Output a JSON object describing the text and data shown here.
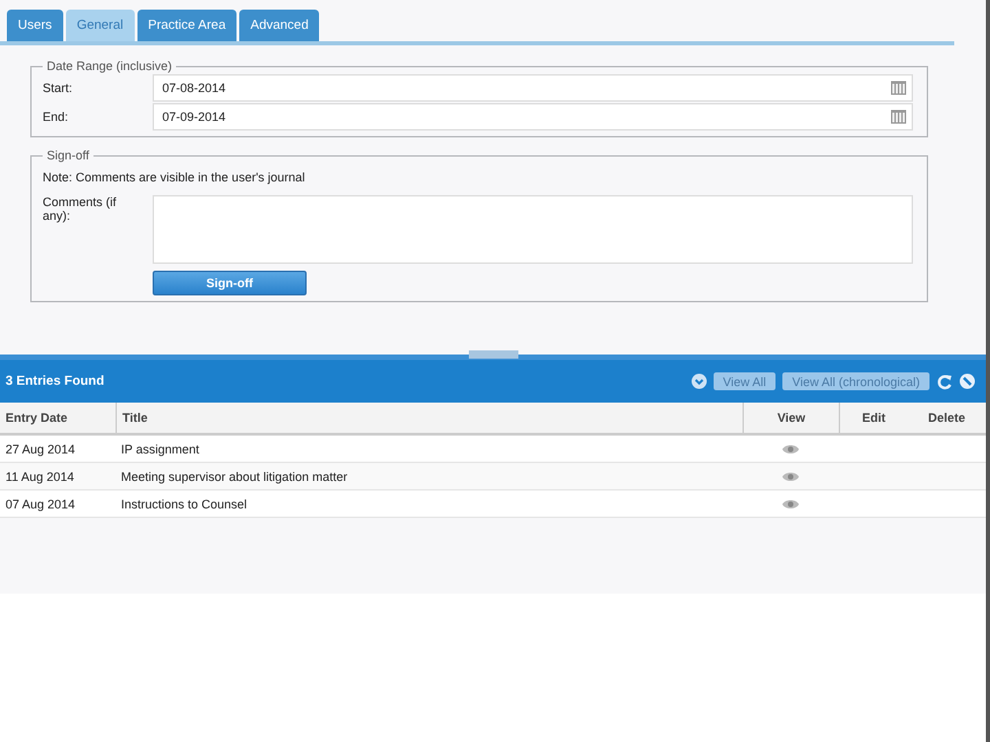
{
  "tabs": [
    {
      "label": "Users",
      "selected": false
    },
    {
      "label": "General",
      "selected": true
    },
    {
      "label": "Practice Area",
      "selected": false
    },
    {
      "label": "Advanced",
      "selected": false
    }
  ],
  "date_range": {
    "legend": "Date Range (inclusive)",
    "fields": [
      {
        "label": "Start:",
        "value": "07-08-2014"
      },
      {
        "label": "End:",
        "value": "07-09-2014"
      }
    ]
  },
  "signoff": {
    "legend": "Sign-off",
    "note": "Note: Comments are visible in the user's journal",
    "comments_label": "Comments (if any):",
    "button": "Sign-off"
  },
  "entries": {
    "title": "3 Entries Found",
    "buttons": [
      "View All",
      "View All (chronological)"
    ],
    "columns": [
      "Entry Date",
      "Title",
      "View",
      "Edit",
      "Delete"
    ],
    "rows": [
      {
        "date": "27 Aug 2014",
        "title": "IP assignment"
      },
      {
        "date": "11 Aug 2014",
        "title": "Meeting supervisor about litigation matter"
      },
      {
        "date": "07 Aug 2014",
        "title": "Instructions to Counsel"
      }
    ]
  }
}
